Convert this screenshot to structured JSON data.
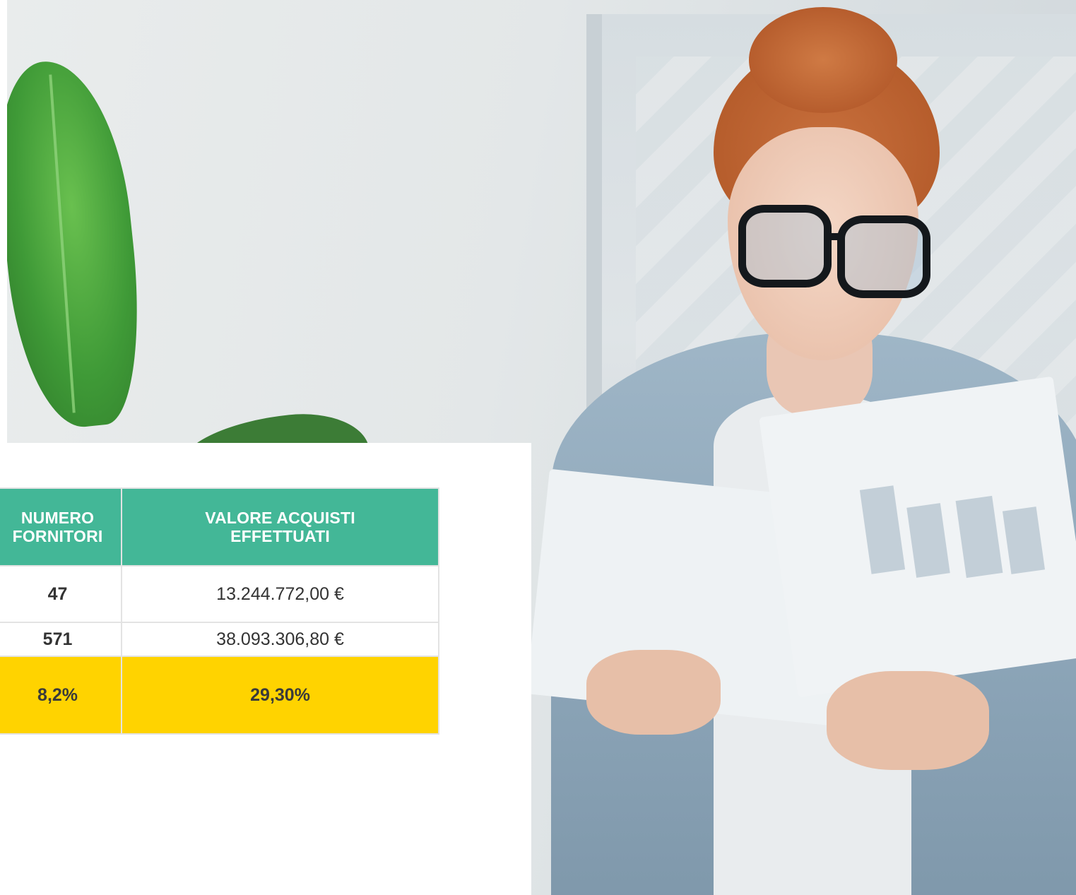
{
  "table": {
    "headers": [
      {
        "line1": "NUMERO",
        "line2": "FORNITORI"
      },
      {
        "line1": "VALORE ACQUISTI",
        "line2": "EFFETTUATI"
      }
    ],
    "rows": [
      {
        "fornitori": "47",
        "valore": "13.244.772,00 €"
      },
      {
        "fornitori": "571",
        "valore": "38.093.306,80 €"
      },
      {
        "fornitori": "8,2%",
        "valore": "29,30%"
      }
    ]
  },
  "colors": {
    "header_bg": "#43b797",
    "highlight_row_bg": "#ffd300",
    "header_text": "#ffffff"
  },
  "photo": {
    "icon": "photo-woman-reading-report"
  }
}
